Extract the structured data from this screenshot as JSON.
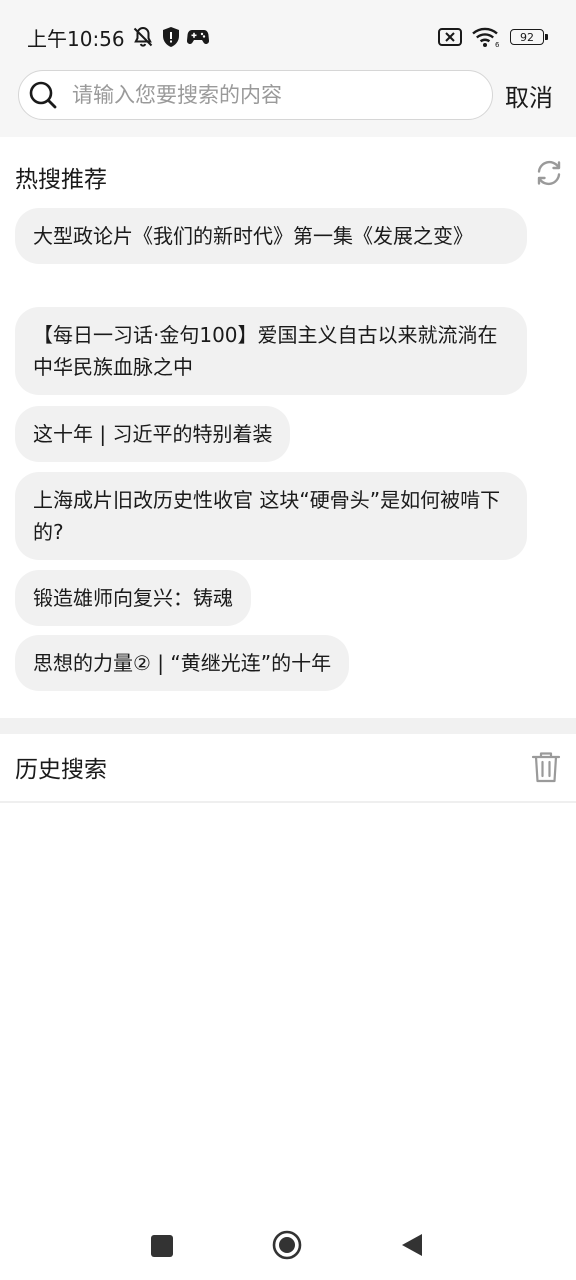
{
  "status_bar": {
    "time": "上午10:56",
    "battery": "92",
    "icons": [
      "bell-off-icon",
      "shield-icon",
      "gamepad-icon",
      "sim-off-icon",
      "wifi-icon",
      "battery-icon"
    ]
  },
  "search": {
    "placeholder": "请输入您要搜索的内容",
    "value": "",
    "cancel_label": "取消"
  },
  "hot": {
    "title": "热搜推荐",
    "items": [
      {
        "label": "大型政论片《我们的新时代》第一集《发展之变》"
      },
      {
        "label": "【每日一习话·金句100】爱国主义自古以来就流淌在中华民族血脉之中"
      },
      {
        "label": "这十年 | 习近平的特别着装"
      },
      {
        "label": "上海成片旧改历史性收官 这块“硬骨头”是如何被啃下的?"
      },
      {
        "label": "锻造雄师向复兴：铸魂"
      },
      {
        "label": "思想的力量② | “黄继光连”的十年"
      }
    ]
  },
  "history": {
    "title": "历史搜索",
    "items": []
  },
  "colors": {
    "top_background": "#f6f6f6",
    "chip_background": "#f1f1f1",
    "text": "#1a1a1a",
    "placeholder": "#9a9a9a",
    "icon_gray": "#9a9a9a"
  }
}
